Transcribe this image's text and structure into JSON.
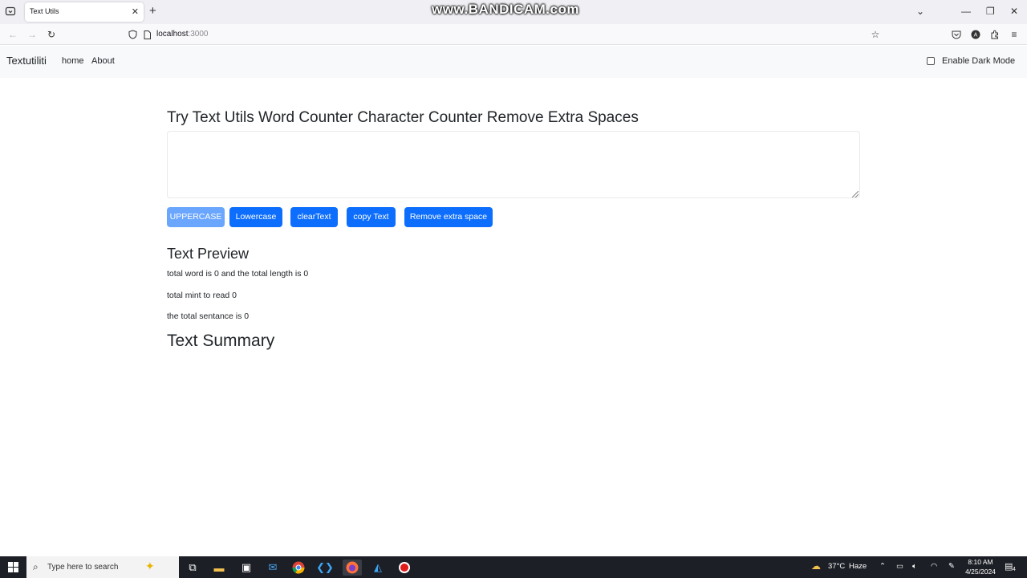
{
  "browser": {
    "tab_title": "Text Utils",
    "tab_close": "✕",
    "new_tab": "+",
    "url_host": "localhost",
    "url_port": ":3000",
    "watermark": "www.BANDICAM.com",
    "window_controls": {
      "minimize": "—",
      "restore": "❐",
      "close": "✕",
      "tab_list": "⌄"
    }
  },
  "app": {
    "brand": "Textutiliti",
    "nav": {
      "home": "home",
      "about": "About"
    },
    "dark_mode_label": "Enable Dark Mode",
    "dark_mode_checked": false,
    "heading": "Try Text Utils Word Counter Character Counter Remove Extra Spaces",
    "textarea_value": "",
    "buttons": {
      "uppercase": "UPPERCASE",
      "lowercase": "Lowercase",
      "clear": "clearText",
      "copy": "copy Text",
      "remove_space": "Remove extra space"
    },
    "preview_title": "Text Preview",
    "stats": {
      "words_length": "total word is 0 and the total length is 0",
      "read_time": "total mint to read 0",
      "sentences": "the total sentance is 0"
    },
    "summary_title": "Text Summary"
  },
  "taskbar": {
    "search_placeholder": "Type here to search",
    "weather_temp": "37°C",
    "weather_desc": "Haze",
    "time": "8:10 AM",
    "date": "4/25/2024",
    "notification_count": "4"
  },
  "colors": {
    "primary": "#0d6efd",
    "primary_disabled": "#6aa6fd",
    "navbar_bg": "#f8f9fa",
    "taskbar_bg": "#1c1f26"
  }
}
